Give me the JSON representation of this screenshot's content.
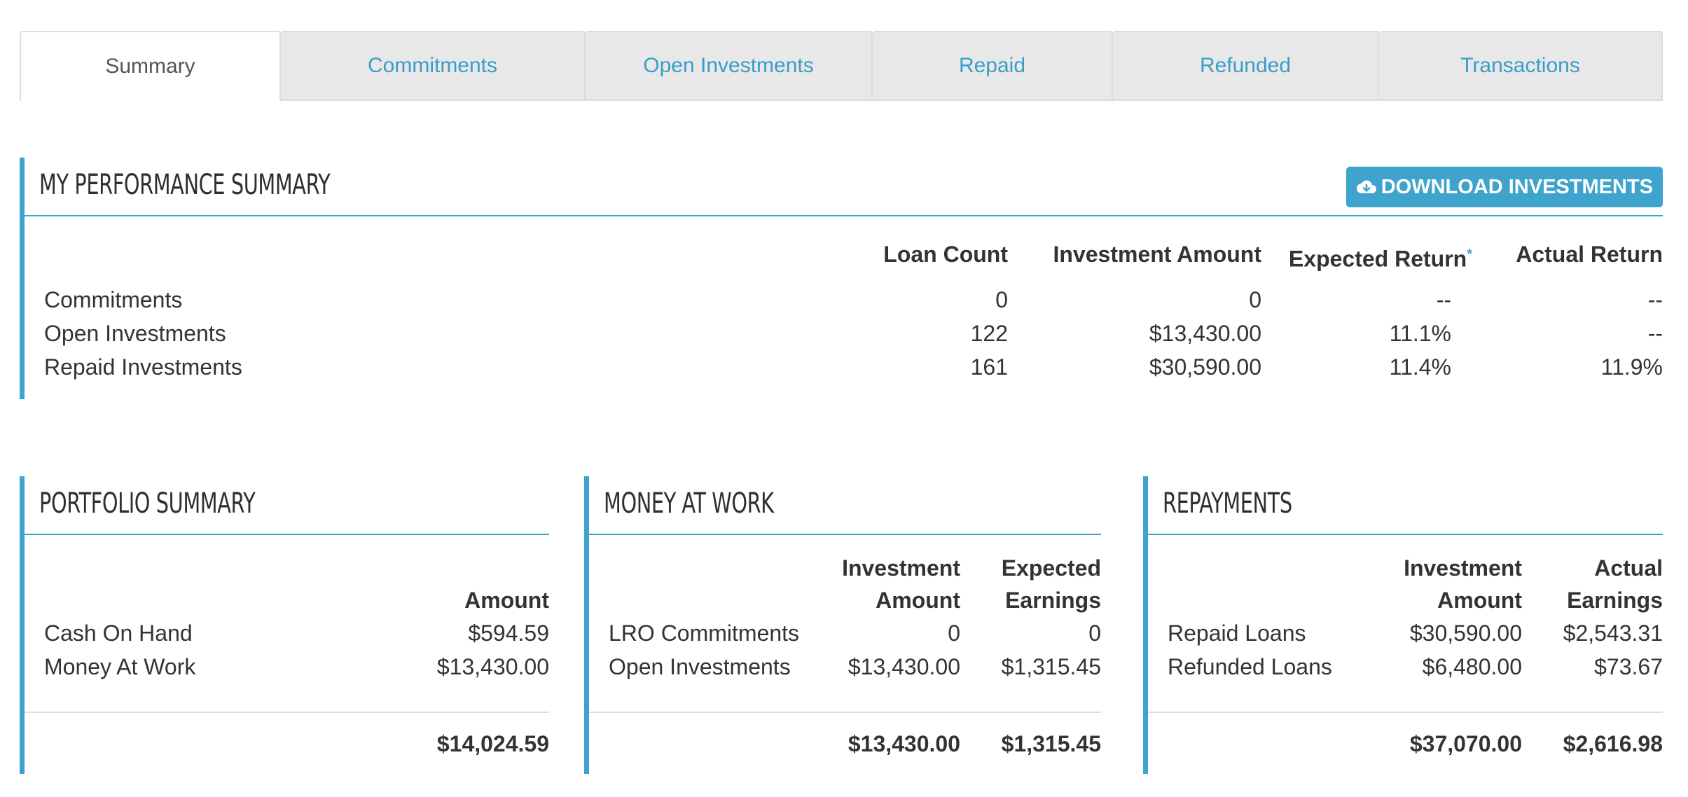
{
  "tabs": [
    {
      "label": "Summary",
      "active": true
    },
    {
      "label": "Commitments"
    },
    {
      "label": "Open Investments"
    },
    {
      "label": "Repaid"
    },
    {
      "label": "Refunded"
    },
    {
      "label": "Transactions"
    }
  ],
  "performance": {
    "title": "MY PERFORMANCE SUMMARY",
    "download_label": "DOWNLOAD INVESTMENTS",
    "download_icon": "cloud-download-icon",
    "headers": [
      "Loan Count",
      "Investment Amount",
      "Expected Return",
      "Actual Return"
    ],
    "expected_marker": "*",
    "rows": [
      {
        "label": "Commitments",
        "loan_count": "0",
        "investment_amount": "0",
        "expected_return": "--",
        "actual_return": "--"
      },
      {
        "label": "Open Investments",
        "loan_count": "122",
        "investment_amount": "$13,430.00",
        "expected_return": "11.1%",
        "actual_return": "--"
      },
      {
        "label": "Repaid Investments",
        "loan_count": "161",
        "investment_amount": "$30,590.00",
        "expected_return": "11.4%",
        "actual_return": "11.9%"
      }
    ]
  },
  "portfolio": {
    "title": "PORTFOLIO SUMMARY",
    "header": "Amount",
    "rows": [
      {
        "label": "Cash On Hand",
        "amount": "$594.59"
      },
      {
        "label": "Money At Work",
        "amount": "$13,430.00"
      }
    ],
    "total": "$14,024.59"
  },
  "money_at_work": {
    "title": "MONEY AT WORK",
    "headers": [
      [
        "Investment",
        "Amount"
      ],
      [
        "Expected",
        "Earnings"
      ]
    ],
    "rows": [
      {
        "label": "LRO Commitments",
        "investment_amount": "0",
        "expected_earnings": "0"
      },
      {
        "label": "Open Investments",
        "investment_amount": "$13,430.00",
        "expected_earnings": "$1,315.45"
      }
    ],
    "totals": {
      "investment_amount": "$13,430.00",
      "expected_earnings": "$1,315.45"
    }
  },
  "repayments": {
    "title": "REPAYMENTS",
    "headers": [
      [
        "Investment",
        "Amount"
      ],
      [
        "Actual",
        "Earnings"
      ]
    ],
    "rows": [
      {
        "label": "Repaid Loans",
        "investment_amount": "$30,590.00",
        "actual_earnings": "$2,543.31"
      },
      {
        "label": "Refunded Loans",
        "investment_amount": "$6,480.00",
        "actual_earnings": "$73.67"
      }
    ],
    "totals": {
      "investment_amount": "$37,070.00",
      "actual_earnings": "$2,616.98"
    }
  },
  "colors": {
    "accent": "#3ea3cd",
    "tab_link": "#3a9dc8",
    "tab_inactive_bg": "#e8e8e8"
  }
}
